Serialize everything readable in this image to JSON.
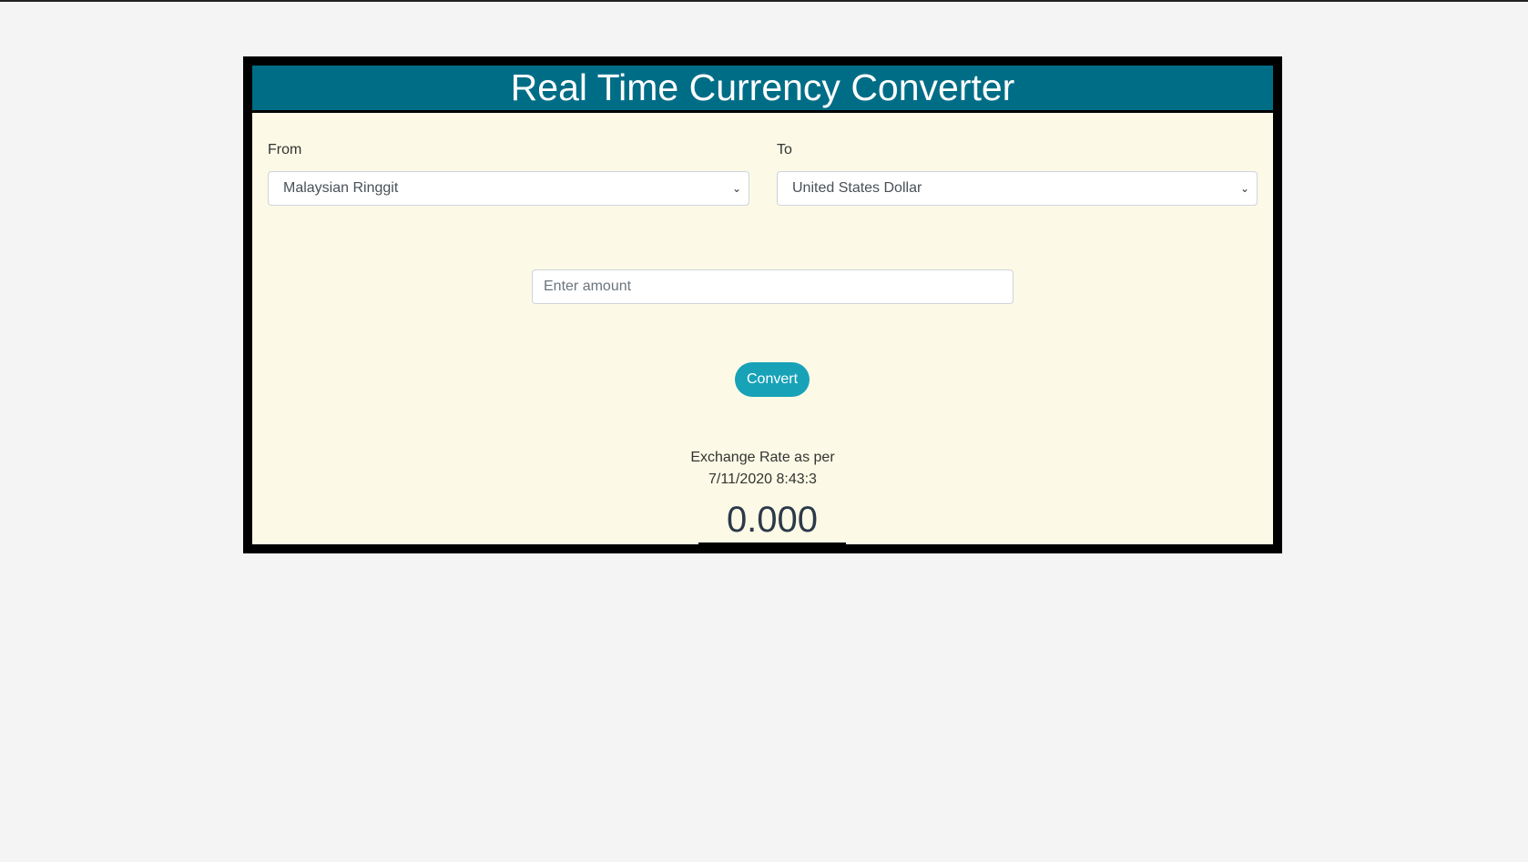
{
  "header": {
    "title": "Real Time Currency Converter"
  },
  "from": {
    "label": "From",
    "value": "Malaysian Ringgit"
  },
  "to": {
    "label": "To",
    "value": "United States Dollar"
  },
  "amount": {
    "placeholder": "Enter amount",
    "value": ""
  },
  "convert_label": "Convert",
  "result": {
    "caption": "Exchange Rate as per",
    "timestamp": "7/11/2020 8:43:3",
    "value": "0.000"
  },
  "colors": {
    "header": "#006d87",
    "button": "#17a2b8",
    "panel": "#fcfae6"
  }
}
